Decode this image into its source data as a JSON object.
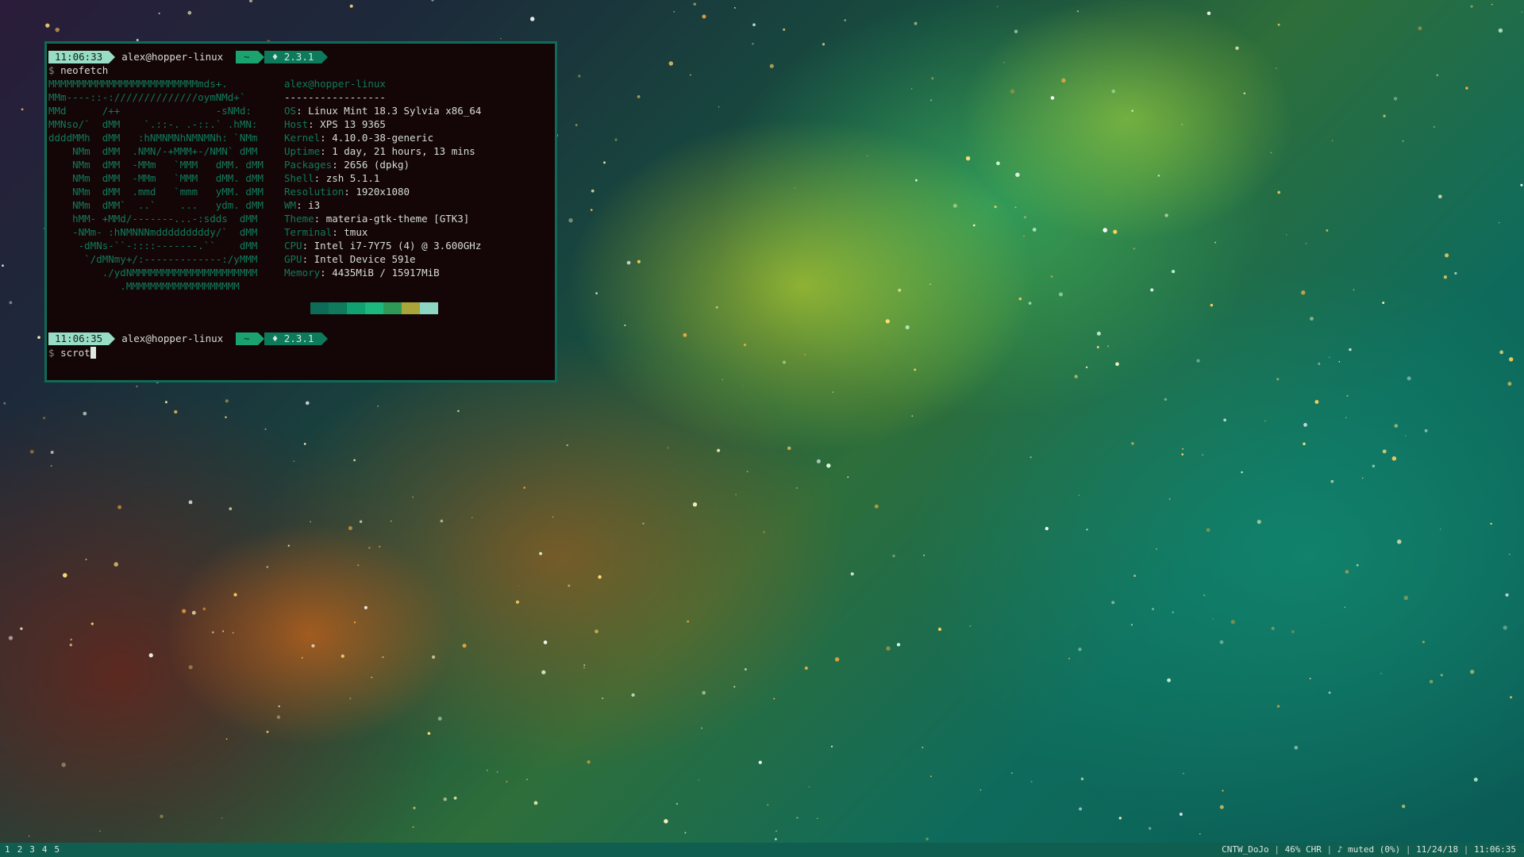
{
  "terminal": {
    "prompt1": {
      "time": "11:06:33",
      "user": "alex@hopper-linux",
      "dir": "~",
      "ver": "♦ 2.3.1"
    },
    "command1": "neofetch",
    "logo": [
      "MMMMMMMMMMMMMMMMMMMMMMMMMmds+.",
      "MMm----::-://////////////oymNMd+`",
      "MMd      /++                -sNMd:",
      "MMNso/`  dMM    `.::-. .-::.` .hMN:",
      "ddddMMh  dMM   :hNMNMNhNMNMNh: `NMm",
      "    NMm  dMM  .NMN/-+MMM+-/NMN` dMM",
      "    NMm  dMM  -MMm   `MMM   dMM. dMM",
      "    NMm  dMM  -MMm   `MMM   dMM. dMM",
      "    NMm  dMM  .mmd   `mmm   yMM. dMM",
      "    NMm  dMM`  ..`    ...   ydm. dMM",
      "    hMM- +MMd/-------...-:sdds  dMM",
      "    -NMm- :hNMNNNmdddddddddy/`  dMM",
      "     -dMNs-``-::::-------.``    dMM",
      "      `/dMNmy+/:-------------:/yMMM",
      "         ./ydNMMMMMMMMMMMMMMMMMMMMM",
      "            .MMMMMMMMMMMMMMMMMMM"
    ],
    "info_title": "alex@hopper-linux",
    "info_sep": "-----------------",
    "info": [
      {
        "key": "OS",
        "value": "Linux Mint 18.3 Sylvia x86_64"
      },
      {
        "key": "Host",
        "value": "XPS 13 9365"
      },
      {
        "key": "Kernel",
        "value": "4.10.0-38-generic"
      },
      {
        "key": "Uptime",
        "value": "1 day, 21 hours, 13 mins"
      },
      {
        "key": "Packages",
        "value": "2656 (dpkg)"
      },
      {
        "key": "Shell",
        "value": "zsh 5.1.1"
      },
      {
        "key": "Resolution",
        "value": "1920x1080"
      },
      {
        "key": "WM",
        "value": "i3"
      },
      {
        "key": "Theme",
        "value": "materia-gtk-theme [GTK3]"
      },
      {
        "key": "Terminal",
        "value": "tmux"
      },
      {
        "key": "CPU",
        "value": "Intel i7-7Y75 (4) @ 3.600GHz"
      },
      {
        "key": "GPU",
        "value": "Intel Device 591e"
      },
      {
        "key": "Memory",
        "value": "4435MiB / 15917MiB"
      }
    ],
    "swatch_colors": [
      "#0e6b57",
      "#0f7a5c",
      "#11a070",
      "#1db87e",
      "#2f9a57",
      "#a8a63a",
      "#8dd6c3"
    ],
    "prompt2": {
      "time": "11:06:35",
      "user": "alex@hopper-linux",
      "dir": "~",
      "ver": "♦ 2.3.1"
    },
    "command2": "scrot",
    "dollar": "$"
  },
  "statusbar": {
    "workspaces": [
      "1",
      "2",
      "3",
      "4",
      "5"
    ],
    "network": "CNTW_DoJo",
    "battery": "46% CHR",
    "volume": "♪ muted (0%)",
    "date": "11/24/18",
    "time": "11:06:35",
    "separator": "|"
  }
}
